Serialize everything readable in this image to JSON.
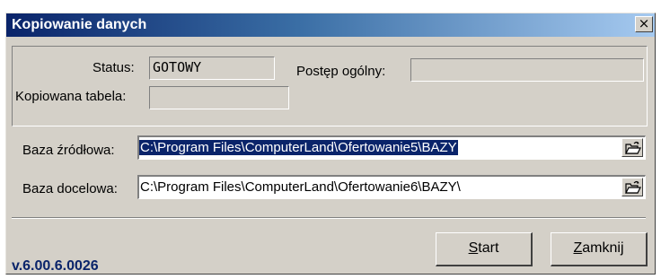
{
  "window": {
    "title": "Kopiowanie danych",
    "close_glyph": "×"
  },
  "status_group": {
    "status_label": "Status:",
    "status_value": "GOTOWY",
    "progress_label": "Postęp ogólny:",
    "progress_value": "",
    "table_label": "Kopiowana tabela:",
    "table_value": ""
  },
  "source": {
    "label": "Baza źródłowa:",
    "value": "C:\\Program Files\\ComputerLand\\Ofertowanie5\\BAZY",
    "selected": true
  },
  "target": {
    "label": "Baza docelowa:",
    "value": "C:\\Program Files\\ComputerLand\\Ofertowanie6\\BAZY\\"
  },
  "footer": {
    "version": "v.6.00.6.0026",
    "start_mnemonic": "S",
    "start_rest": "tart",
    "close_mnemonic": "Z",
    "close_rest": "amknij"
  },
  "icons": {
    "browse": "open-folder-icon",
    "close": "close-icon"
  },
  "colors": {
    "title_start": "#0a246a",
    "title_end": "#a6caf0",
    "face": "#d4d0c8",
    "selection": "#0a246a",
    "version_text": "#0a246a"
  }
}
